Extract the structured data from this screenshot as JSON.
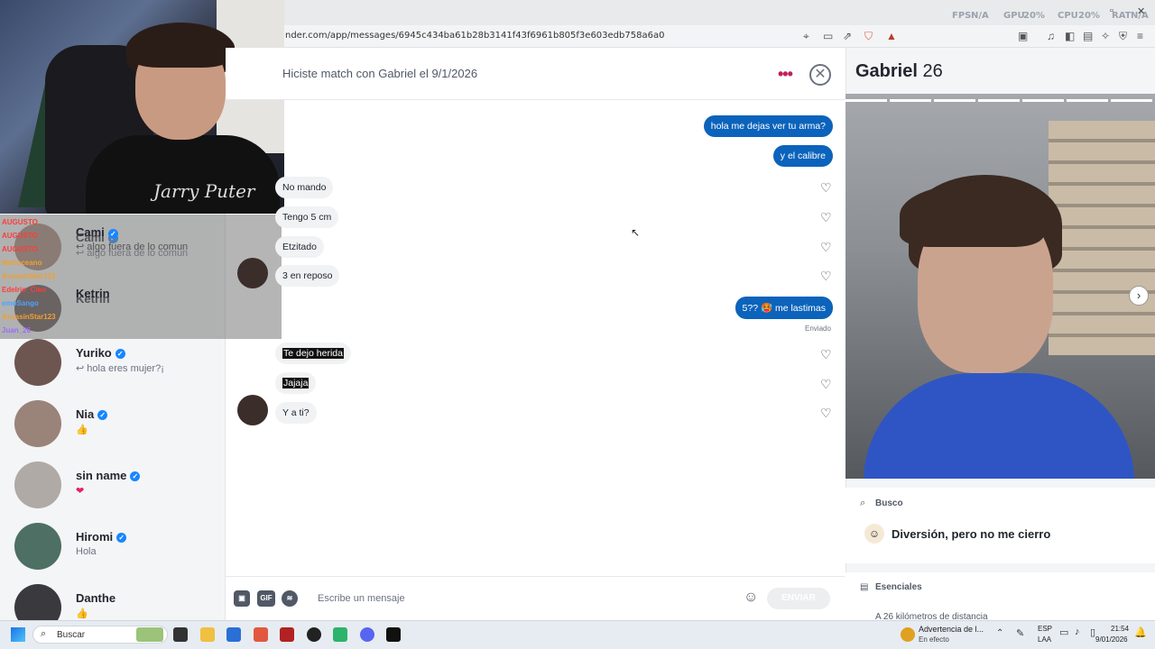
{
  "browser": {
    "url": "nder.com/app/messages/6945c434ba61b28b3141f43f6961b805f3e603edb758a6a0",
    "perf": {
      "fps_label": "FPS",
      "fps": "N/A",
      "gpu_label": "GPU",
      "gpu": "20%",
      "cpu_label": "CPU",
      "cpu": "20%",
      "ram_label": "RAT",
      "ram": "N/A"
    }
  },
  "chat_header": {
    "match_text": "Hiciste match con Gabriel el 9/1/2026",
    "more": "•••",
    "close": "✕"
  },
  "messages": [
    {
      "dir": "out",
      "text": "hola me dejas ver tu arma?"
    },
    {
      "dir": "out",
      "text": "y el calibre"
    },
    {
      "dir": "in",
      "text": "No mando"
    },
    {
      "dir": "in",
      "text": "Tengo 5 cm"
    },
    {
      "dir": "in",
      "text": "Etzitado"
    },
    {
      "dir": "in",
      "text": "3 en reposo"
    },
    {
      "dir": "out",
      "text": "5?? 🥵 me lastimas"
    },
    {
      "dir": "in",
      "text": "Te dejo herida"
    },
    {
      "dir": "in",
      "text": "Jajaja"
    },
    {
      "dir": "in",
      "text": "Y a ti?"
    }
  ],
  "sent_status": "Enviado",
  "composer": {
    "placeholder": "Escribe un mensaje",
    "gif": "GIF",
    "send": "ENVIAR"
  },
  "sidebar": [
    {
      "name": "Cami",
      "preview": "↩ algo fuera de lo comun"
    },
    {
      "name": "Ketrin",
      "preview": ""
    },
    {
      "name": "Yuriko",
      "preview": "↩ hola eres mujer?¡"
    },
    {
      "name": "Nia",
      "preview": "👍"
    },
    {
      "name": "sin name",
      "preview": "❤"
    },
    {
      "name": "Hiromi",
      "preview": "Hola"
    },
    {
      "name": "Danthe",
      "preview": "👍"
    }
  ],
  "stream_chat": [
    {
      "user": "AUGUSTO",
      "color": "#ff3b3b"
    },
    {
      "user": "AUGUSTO",
      "color": "#ff3b3b"
    },
    {
      "user": "AUGUSTO",
      "color": "#ff3b3b"
    },
    {
      "user": "Marloceano",
      "color": "#f0a030"
    },
    {
      "user": "AssasinStar123",
      "color": "#f0a030"
    },
    {
      "user": "Edelrio_Cleo",
      "color": "#ff3b3b"
    },
    {
      "user": "emoSango",
      "color": "#4aa3ff"
    },
    {
      "user": "AssasinStar123",
      "color": "#f0a030"
    },
    {
      "user": "Juan_26",
      "color": "#9b6bff"
    }
  ],
  "stream_shirt": "Jarry Puter",
  "profile": {
    "name": "Gabriel",
    "age": "26",
    "looking_for_label": "Busco",
    "looking_for_value": "Diversión, pero no me cierro",
    "essentials_label": "Esenciales",
    "essentials_first": "A 26 kilómetros de distancia"
  },
  "taskbar": {
    "search": "Buscar",
    "warning_title": "Advertencia de l...",
    "warning_sub": "En efecto",
    "lang": "ESP",
    "lang_sub": "LAA",
    "time": "21:54",
    "date": "9/01/2026"
  }
}
